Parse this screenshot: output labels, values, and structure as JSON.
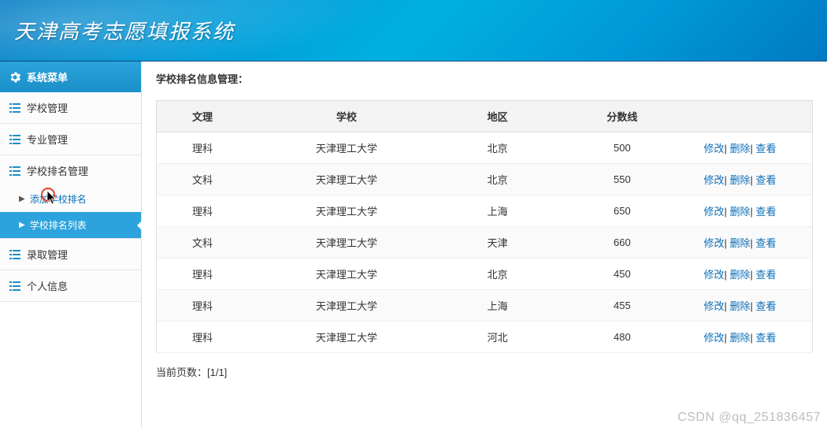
{
  "header": {
    "title": "天津高考志愿填报系统"
  },
  "sidebar": {
    "menu_header": "系统菜单",
    "groups": [
      {
        "label": "学校管理"
      },
      {
        "label": "专业管理"
      },
      {
        "label": "学校排名管理",
        "items": [
          {
            "label": "添加学校排名",
            "active": false
          },
          {
            "label": "学校排名列表",
            "active": true
          }
        ]
      },
      {
        "label": "录取管理"
      },
      {
        "label": "个人信息"
      }
    ]
  },
  "main": {
    "title": "学校排名信息管理：",
    "columns": [
      "文理",
      "学校",
      "地区",
      "分数线"
    ],
    "rows": [
      {
        "type": "理科",
        "school": "天津理工大学",
        "region": "北京",
        "score": "500"
      },
      {
        "type": "文科",
        "school": "天津理工大学",
        "region": "北京",
        "score": "550"
      },
      {
        "type": "理科",
        "school": "天津理工大学",
        "region": "上海",
        "score": "650"
      },
      {
        "type": "文科",
        "school": "天津理工大学",
        "region": "天津",
        "score": "660"
      },
      {
        "type": "理科",
        "school": "天津理工大学",
        "region": "北京",
        "score": "450"
      },
      {
        "type": "理科",
        "school": "天津理工大学",
        "region": "上海",
        "score": "455"
      },
      {
        "type": "理科",
        "school": "天津理工大学",
        "region": "河北",
        "score": "480"
      }
    ],
    "actions": {
      "edit": "修改",
      "delete": "删除",
      "view": "查看"
    },
    "pagination": "当前页数：[1/1]"
  },
  "watermark": "CSDN @qq_251836457"
}
